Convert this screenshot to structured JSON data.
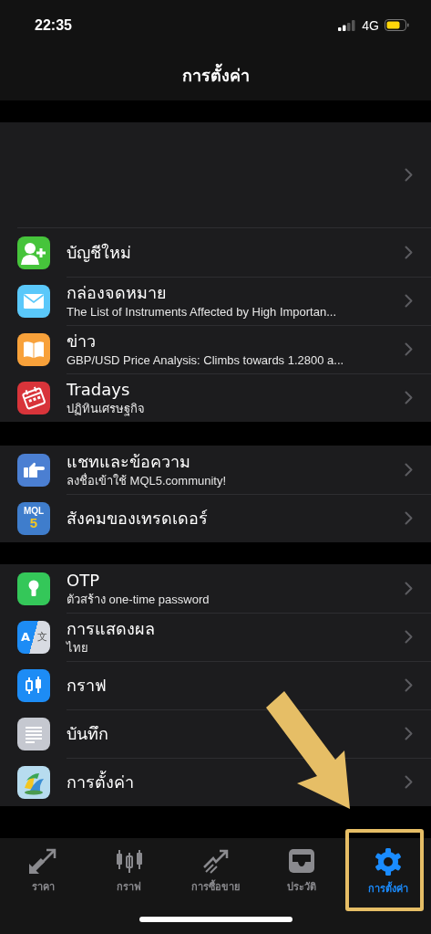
{
  "status_bar": {
    "time": "22:35",
    "network": "4G"
  },
  "nav": {
    "title": "การตั้งค่า"
  },
  "sections": [
    {
      "rows": [
        {
          "title": "บัญชีใหม่"
        },
        {
          "title": "กล่องจดหมาย",
          "subtitle": "The List of Instruments Affected by High Importan..."
        },
        {
          "title": "ข่าว",
          "subtitle": "GBP/USD Price Analysis: Climbs towards 1.2800 a..."
        },
        {
          "title": "Tradays",
          "subtitle": "ปฏิทินเศรษฐกิจ"
        }
      ]
    },
    {
      "rows": [
        {
          "title": "แชทและข้อความ",
          "subtitle": "ลงชื่อเข้าใช้ MQL5.community!"
        },
        {
          "title": "สังคมของเทรดเดอร์",
          "icon_text": [
            "MQL",
            "5"
          ]
        }
      ]
    },
    {
      "rows": [
        {
          "title": "OTP",
          "subtitle": "ตัวสร้าง one-time password"
        },
        {
          "title": "การแสดงผล",
          "subtitle": "ไทย",
          "icon_text": [
            "A",
            "文"
          ]
        },
        {
          "title": "กราฟ"
        },
        {
          "title": "บันทึก"
        },
        {
          "title": "การตั้งค่า"
        }
      ]
    }
  ],
  "tabs": [
    {
      "label": "ราคา",
      "selected": false
    },
    {
      "label": "กราฟ",
      "selected": false
    },
    {
      "label": "การซื้อขาย",
      "selected": false
    },
    {
      "label": "ประวัติ",
      "selected": false
    },
    {
      "label": "การตั้งค่า",
      "selected": true
    }
  ]
}
